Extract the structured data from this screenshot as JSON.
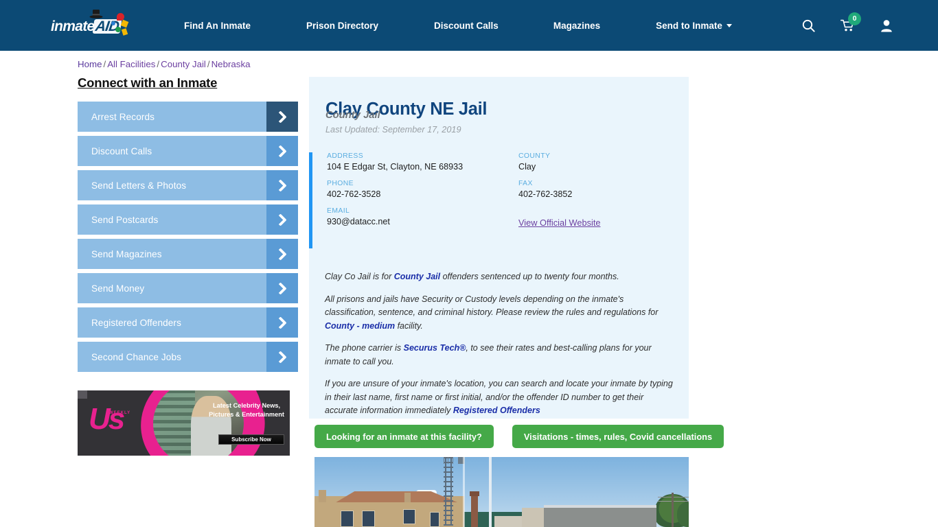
{
  "header": {
    "logo": {
      "text_primary": "inmate",
      "text_secondary": "AID",
      "icon": "logo-icon"
    },
    "nav": [
      {
        "label": "Find An Inmate"
      },
      {
        "label": "Prison Directory"
      },
      {
        "label": "Discount Calls"
      },
      {
        "label": "Magazines"
      },
      {
        "label": "Send to Inmate",
        "has_dropdown": true
      }
    ],
    "icons": {
      "search": "search-icon",
      "cart": "cart-icon",
      "cart_badge": "0",
      "account": "user-account-icon"
    },
    "background_color": "#0c4a75",
    "badge_color": "#20a97a"
  },
  "breadcrumb": {
    "items": [
      {
        "label": "Home"
      },
      {
        "label": "All Facilities"
      },
      {
        "label": "County Jail"
      },
      {
        "label": "Nebraska"
      }
    ],
    "separator": "/"
  },
  "sidebar": {
    "title": "Connect with an Inmate",
    "items": [
      {
        "label": "Arrest Records",
        "active": true
      },
      {
        "label": "Discount Calls",
        "active": false
      },
      {
        "label": "Send Letters & Photos",
        "active": false
      },
      {
        "label": "Send Postcards",
        "active": false
      },
      {
        "label": "Send Magazines",
        "active": false
      },
      {
        "label": "Send Money",
        "active": false
      },
      {
        "label": "Registered Offenders",
        "active": false
      },
      {
        "label": "Second Chance Jobs",
        "active": false
      }
    ]
  },
  "advertisement": {
    "brand": "Us",
    "brand_sub": "WEEKLY",
    "copy": "Latest Celebrity News, Pictures & Entertainment",
    "cta_label": "Subscribe Now"
  },
  "facility": {
    "name": "Clay County NE Jail",
    "type": "County Jail",
    "last_updated": "Last Updated: September 17, 2019",
    "contact": {
      "address_label": "ADDRESS",
      "address_value": "104 E Edgar St, Clayton, NE 68933",
      "county_label": "COUNTY",
      "county_value": "Clay",
      "phone_label": "PHONE",
      "phone_value": "402-762-3528",
      "fax_label": "FAX",
      "fax_value": "402-762-3852",
      "email_label": "EMAIL",
      "email_value": "930@datacc.net",
      "website_link": "View Official Website"
    },
    "description": {
      "p1_a": "Clay Co Jail is for ",
      "p1_link": "County Jail",
      "p1_b": " offenders sentenced up to twenty four months.",
      "p2_a": "All prisons and jails have Security or Custody levels depending on the inmate's classification, sentence, and criminal history. Please review the rules and regulations for ",
      "p2_link": "County - medium",
      "p2_b": " facility.",
      "p3_a": "The phone carrier is ",
      "p3_link": "Securus Tech®",
      "p3_b": ", to see their rates and best-calling plans for your inmate to call you.",
      "p4_a": "If you are unsure of your inmate's location, you can search and locate your inmate by typing in their last name, first name or first initial, and/or the offender ID number to get their accurate information immediately ",
      "p4_link": "Registered Offenders"
    },
    "photo_alt": "Street view photo of Clay County NE Jail building"
  },
  "actions": {
    "inmate_search_label": "Looking for an inmate at this facility?",
    "visitation_label": "Visitations - times, rules, Covid cancellations",
    "button_color": "#45a948"
  }
}
